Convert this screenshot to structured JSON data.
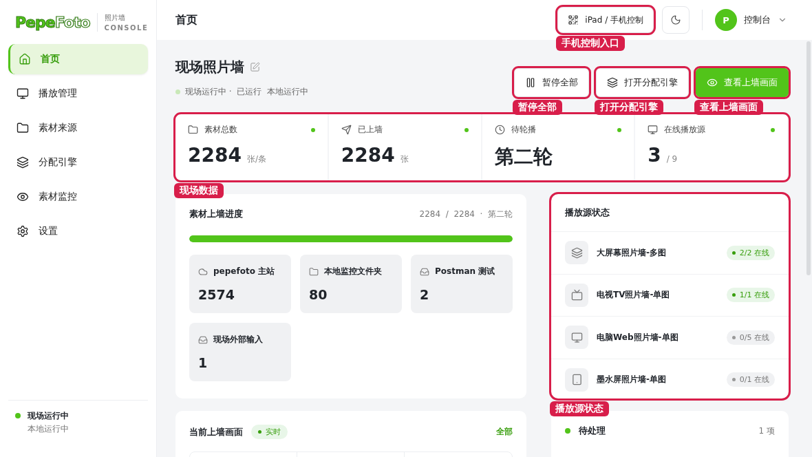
{
  "logo": {
    "part_1": "Pepe",
    "part_2": "Foto",
    "subtitle": "照片墙",
    "caption": "CONSOLE"
  },
  "sidebar": {
    "items": [
      {
        "label": "首页",
        "kind": "home",
        "selected": true
      },
      {
        "label": "播放管理",
        "kind": "monitor",
        "selected": false
      },
      {
        "label": "素材来源",
        "kind": "folder",
        "selected": false
      },
      {
        "label": "分配引擎",
        "kind": "layers",
        "selected": false
      },
      {
        "label": "素材监控",
        "kind": "eye",
        "selected": false
      },
      {
        "label": "设置",
        "kind": "settings",
        "selected": false
      }
    ],
    "status": {
      "title": "现场运行中",
      "detail": "本地运行中",
      "online": true
    }
  },
  "header": {
    "title": "首页",
    "mobile_button": {
      "label": "iPad / 手机控制",
      "callout": "手机控制入口"
    },
    "user": {
      "initial": "P",
      "name": "控制台"
    }
  },
  "page": {
    "title": "现场照片墙",
    "status": "现场运行中 ·  已运行  本地运行中",
    "online": true
  },
  "actions": [
    {
      "label": "暂停全部",
      "kind": "pause",
      "primary": false,
      "callout": "暂停全部"
    },
    {
      "label": "打开分配引擎",
      "kind": "layers",
      "primary": false,
      "callout": "打开分配引擎"
    },
    {
      "label": "查看上墙画面",
      "kind": "eye",
      "primary": true,
      "callout": "查看上墙画面"
    }
  ],
  "stats": {
    "callout": "现场数据",
    "cards": [
      {
        "label": "素材总数",
        "kind": "folder",
        "value": "2284",
        "unit": "张/条",
        "online": true
      },
      {
        "label": "已上墙",
        "kind": "send",
        "value": "2284",
        "unit": "张",
        "online": true
      },
      {
        "label": "待轮播",
        "kind": "clock",
        "value": "第二轮",
        "online": true
      },
      {
        "label": "在线播放源",
        "kind": "monitor",
        "value": "3",
        "unit": "/ 9",
        "online": true
      }
    ]
  },
  "progress": {
    "title": "素材上墙进度",
    "summary": "2284  /  2284  ·  第二轮",
    "level": 1,
    "sources": [
      {
        "name": "pepefoto 主站",
        "kind": "cloud",
        "count": "2574"
      },
      {
        "name": "本地监控文件夹",
        "kind": "folder",
        "count": "80"
      },
      {
        "name": "Postman 测试",
        "kind": "inbox",
        "count": "2"
      },
      {
        "name": "现场外部输入",
        "kind": "inbox",
        "count": "1"
      }
    ]
  },
  "players": {
    "title": "播放源状态",
    "callout": "播放源状态",
    "items": [
      {
        "name": "大屏幕照片墙-多图",
        "kind": "layers",
        "status": "2/2 在线",
        "online": true
      },
      {
        "name": "电视TV照片墙-单图",
        "kind": "tv",
        "status": "1/1 在线",
        "online": true
      },
      {
        "name": "电脑Web照片墙-单图",
        "kind": "monitor",
        "status": "0/5 在线",
        "online": false
      },
      {
        "name": "墨水屏照片墙-单图",
        "kind": "tablet",
        "status": "0/1 在线",
        "online": false
      }
    ]
  },
  "live": {
    "title": "当前上墙画面",
    "badge": "实时",
    "link": "全部"
  },
  "pending": {
    "title": "待处理",
    "count": "1 项",
    "online": true
  }
}
